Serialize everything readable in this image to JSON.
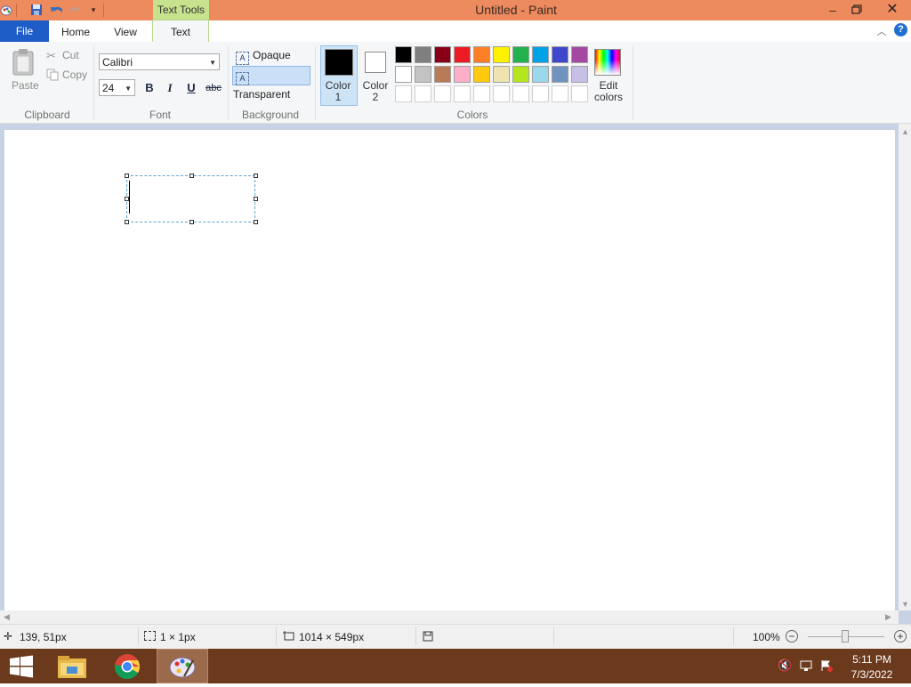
{
  "window": {
    "title": "Untitled - Paint",
    "contextual_tab": "Text Tools"
  },
  "tabs": {
    "file": "File",
    "home": "Home",
    "view": "View",
    "text": "Text"
  },
  "clipboard": {
    "paste": "Paste",
    "cut": "Cut",
    "copy": "Copy",
    "label": "Clipboard"
  },
  "font": {
    "name": "Calibri",
    "size": "24",
    "bold": "B",
    "italic": "I",
    "underline": "U",
    "strikethrough": "abc",
    "label": "Font"
  },
  "background": {
    "opaque": "Opaque",
    "transparent": "Transparent",
    "label": "Background",
    "selected": "Transparent"
  },
  "colors": {
    "color1_line1": "Color",
    "color1_line2": "1",
    "color2_line1": "Color",
    "color2_line2": "2",
    "edit_line1": "Edit",
    "edit_line2": "colors",
    "label": "Colors",
    "color1": "#000000",
    "color2": "#ffffff",
    "palette_row1": [
      "#000000",
      "#7f7f7f",
      "#880015",
      "#ed1c24",
      "#ff7f27",
      "#fff200",
      "#22b14c",
      "#00a2e8",
      "#3f48cc",
      "#a349a4"
    ],
    "palette_row2": [
      "#ffffff",
      "#c3c3c3",
      "#b97a57",
      "#ffaec9",
      "#ffc90e",
      "#efe4b0",
      "#b5e61d",
      "#99d9ea",
      "#7092be",
      "#c8bfe7"
    ],
    "palette_row3": [
      "#ffffff",
      "#ffffff",
      "#ffffff",
      "#ffffff",
      "#ffffff",
      "#ffffff",
      "#ffffff",
      "#ffffff",
      "#ffffff",
      "#ffffff"
    ]
  },
  "status": {
    "cursor_pos": "139, 51px",
    "selection_size": "1 × 1px",
    "image_size": "1014 × 549px",
    "zoom": "100%"
  },
  "taskbar": {
    "time": "5:11 PM",
    "date": "7/3/2022"
  }
}
